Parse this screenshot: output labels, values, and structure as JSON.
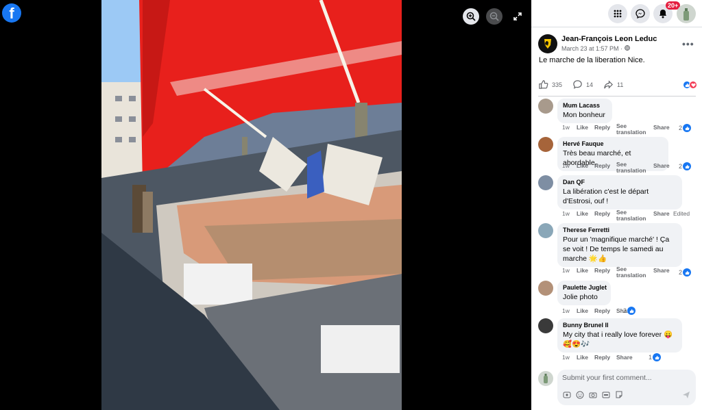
{
  "viewer": {
    "logo_letter": "f"
  },
  "topbar": {
    "notifications_badge": "20+"
  },
  "post": {
    "author": "Jean-François Leon Leduc",
    "time": "March 23 at 1:57 PM",
    "text": "Le marche de la liberation Nice.",
    "likes": "335",
    "comments": "14",
    "shares": "11",
    "more_label": "•••"
  },
  "comments": [
    {
      "name": "Mum Lacass",
      "text": [
        "Mon bonheur"
      ],
      "time": "1w",
      "like": "Like",
      "reply": "Reply",
      "see": [
        "See",
        "translation"
      ],
      "share": "Share",
      "likes": "2"
    },
    {
      "name": "Hervé Fauque",
      "text": [
        "Très beau marché, et abordable."
      ],
      "time": "1w",
      "like": "Like",
      "reply": "Reply",
      "see": [
        "See",
        "translation"
      ],
      "share": "Share",
      "likes": "2"
    },
    {
      "name": "Dan QF",
      "text": [
        "La libération c'est le départ",
        "d'Estrosi, ouf !"
      ],
      "time": "1w",
      "like": "Like",
      "reply": "Reply",
      "see": [
        "See",
        "translation"
      ],
      "share": "Share",
      "edited": "Edited"
    },
    {
      "name": "Therese Ferretti",
      "text": [
        "Pour un 'magnifique marché' ! Ça",
        "se voit ! De temps le samedi au",
        "marche 🌟👍"
      ],
      "time": "1w",
      "like": "Like",
      "reply": "Reply",
      "see": [
        "See",
        "translation"
      ],
      "share": "Share",
      "likes": "2"
    },
    {
      "name": "Paulette Juglet",
      "text": [
        "Jolie photo"
      ],
      "time": "1w",
      "like": "Like",
      "reply": "Reply",
      "share": "Share",
      "likes": "2"
    },
    {
      "name": "Bunny Brunel II",
      "text": [
        "My city that i really love forever 😛",
        "🥰😍🎶"
      ],
      "time": "1w",
      "like": "Like",
      "reply": "Reply",
      "share": "Share",
      "likes": "1"
    }
  ],
  "composer": {
    "placeholder": "Submit your first comment..."
  },
  "icons": {
    "zoom_in": "zoom-in-icon",
    "zoom_out": "zoom-out-icon",
    "expand": "expand-icon",
    "menu": "grid-menu-icon",
    "messenger": "messenger-icon",
    "bell": "bell-icon"
  },
  "colors": {
    "brand": "#1877f2",
    "badge": "#e41e3f",
    "awning": "#e8201c"
  }
}
